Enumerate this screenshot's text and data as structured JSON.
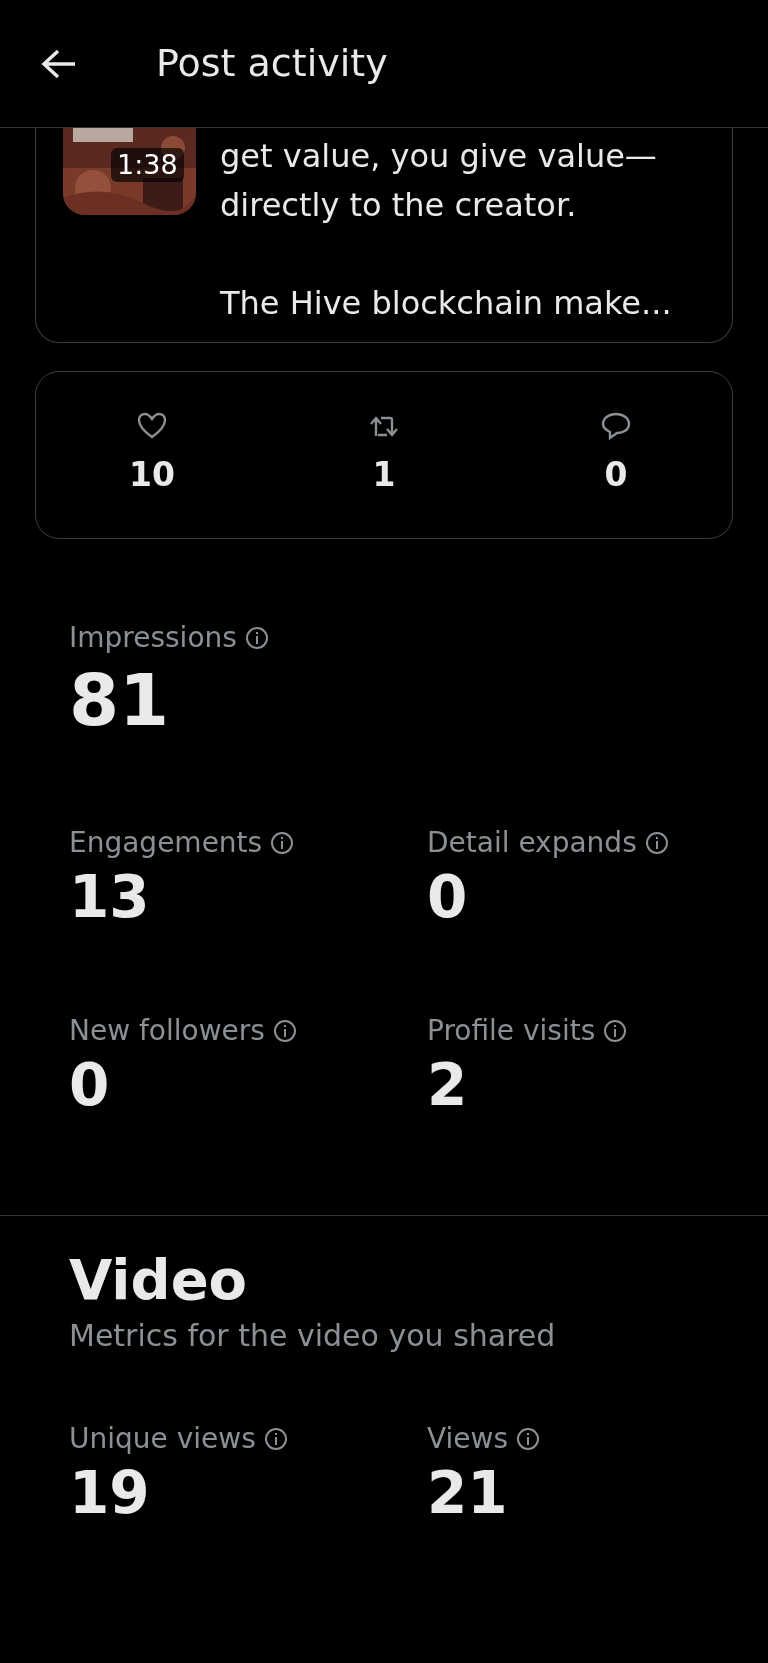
{
  "header": {
    "title": "Post activity"
  },
  "post": {
    "duration": "1:38",
    "text": "get value, you give value—\ndirectly to the creator.\n\nThe Hive blockchain make..."
  },
  "counts": [
    {
      "kind": "like",
      "value": "10"
    },
    {
      "kind": "repost",
      "value": "1"
    },
    {
      "kind": "reply",
      "value": "0"
    }
  ],
  "metric_rows": [
    [
      {
        "label": "Impressions",
        "value": "81",
        "kind": "large"
      }
    ],
    [
      {
        "label": "Engagements",
        "value": "13"
      },
      {
        "label": "Detail expands",
        "value": "0"
      }
    ],
    [
      {
        "label": "New followers",
        "value": "0"
      },
      {
        "label": "Profile visits",
        "value": "2"
      }
    ]
  ],
  "video": {
    "title": "Video",
    "subtitle": "Metrics for the video you shared",
    "metrics": [
      {
        "label": "Unique views",
        "value": "19"
      },
      {
        "label": "Views",
        "value": "21"
      }
    ]
  }
}
